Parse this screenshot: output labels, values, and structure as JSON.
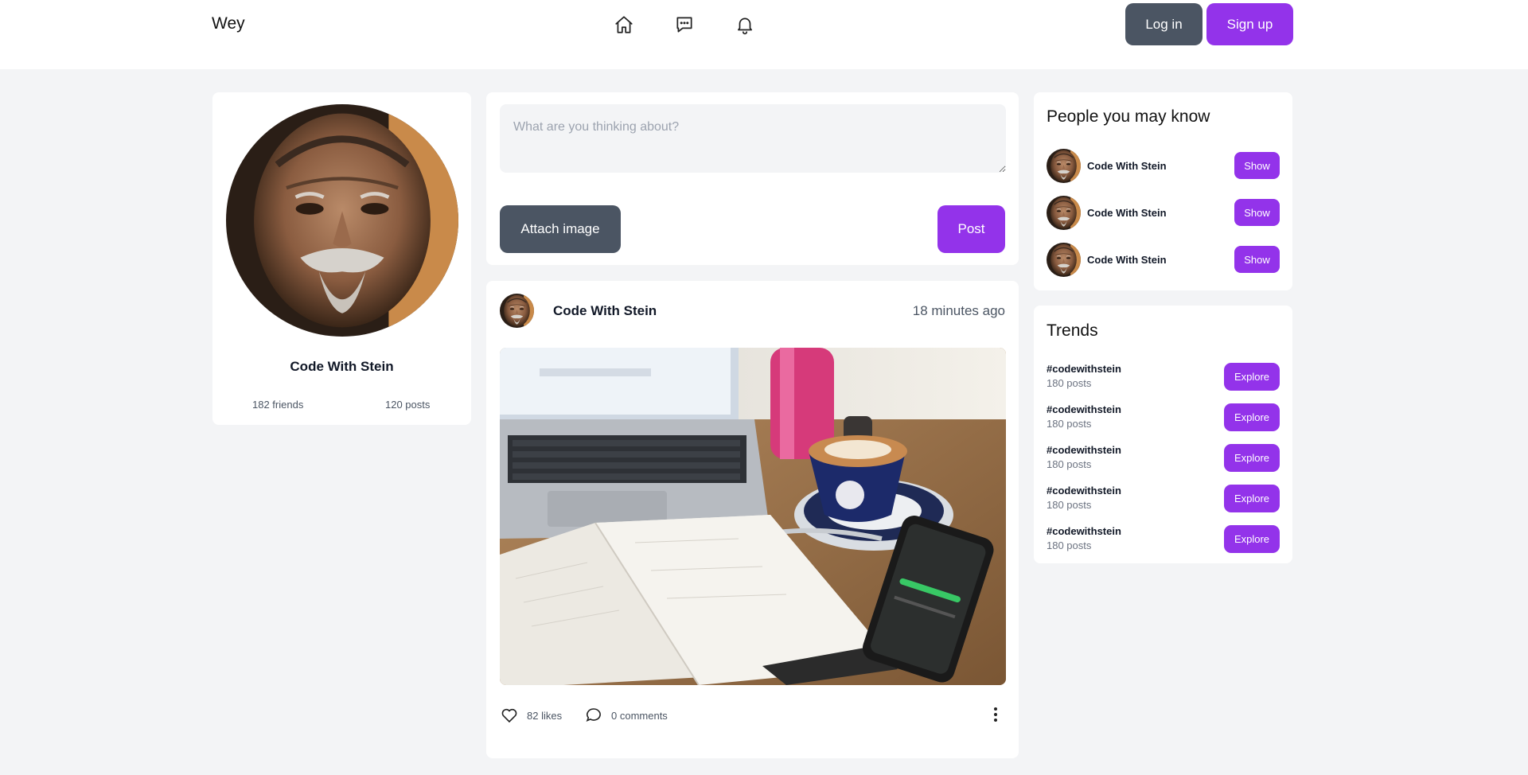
{
  "header": {
    "brand": "Wey",
    "nav": [
      {
        "name": "home",
        "icon": "home-icon"
      },
      {
        "name": "messages",
        "icon": "chat-icon"
      },
      {
        "name": "notifications",
        "icon": "bell-icon"
      }
    ],
    "login_label": "Log in",
    "signup_label": "Sign up"
  },
  "profile": {
    "name": "Code With Stein",
    "friends": "182 friends",
    "posts": "120 posts"
  },
  "composer": {
    "placeholder": "What are you thinking about?",
    "value": "",
    "attach_label": "Attach image",
    "post_label": "Post"
  },
  "feed": {
    "posts": [
      {
        "author": "Code With Stein",
        "time": "18 minutes ago",
        "likes": "82 likes",
        "comments": "0 comments"
      }
    ]
  },
  "people": {
    "title": "People you may know",
    "items": [
      {
        "name": "Code With Stein",
        "action": "Show"
      },
      {
        "name": "Code With Stein",
        "action": "Show"
      },
      {
        "name": "Code With Stein",
        "action": "Show"
      }
    ]
  },
  "trends": {
    "title": "Trends",
    "items": [
      {
        "tag": "#codewithstein",
        "count": "180 posts",
        "action": "Explore"
      },
      {
        "tag": "#codewithstein",
        "count": "180 posts",
        "action": "Explore"
      },
      {
        "tag": "#codewithstein",
        "count": "180 posts",
        "action": "Explore"
      },
      {
        "tag": "#codewithstein",
        "count": "180 posts",
        "action": "Explore"
      },
      {
        "tag": "#codewithstein",
        "count": "180 posts",
        "action": "Explore"
      }
    ]
  },
  "colors": {
    "accent": "#9333ea",
    "dark_button": "#4b5563",
    "background": "#f3f4f6"
  }
}
